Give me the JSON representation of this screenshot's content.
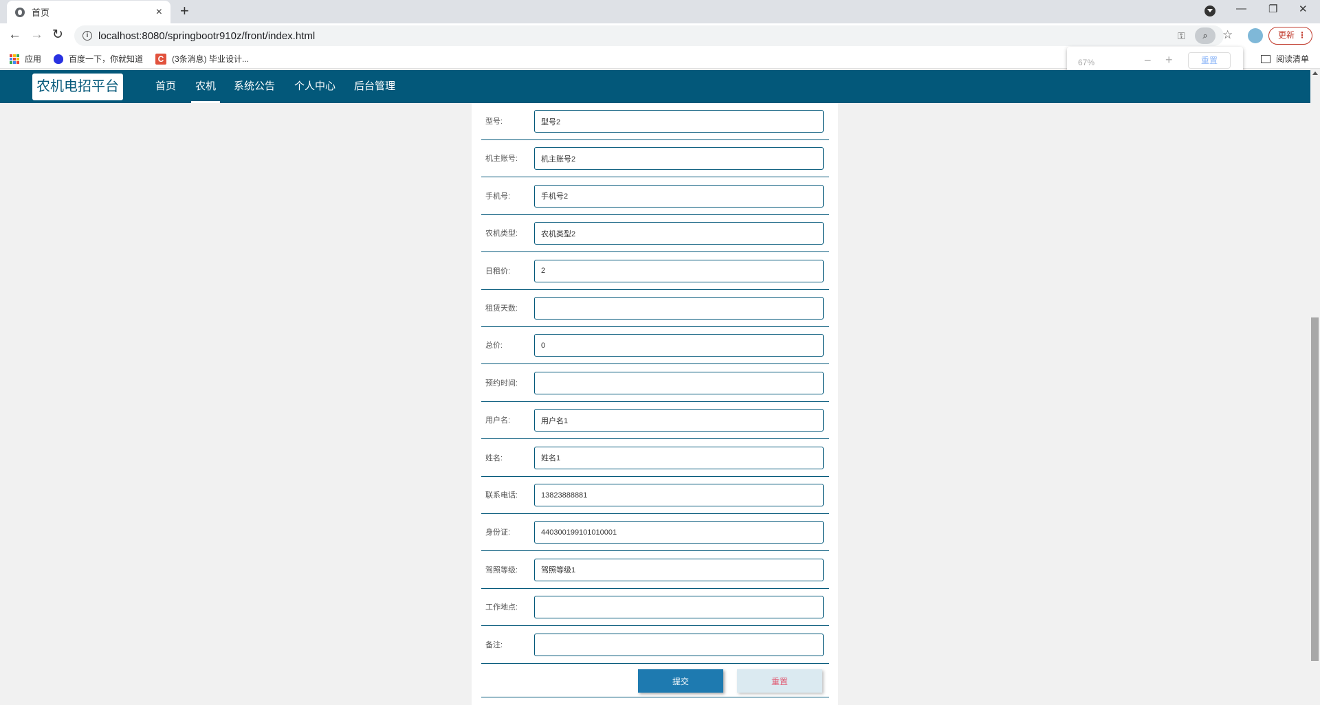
{
  "browser": {
    "tab_title": "首页",
    "tab_close": "×",
    "new_tab": "+",
    "url": "localhost:8080/springbootr910z/front/index.html",
    "update_label": "更新",
    "update_dots": "⋮",
    "window_controls": {
      "minimize": "—",
      "restore": "❐",
      "close": "✕"
    },
    "nav": {
      "back": "←",
      "forward": "→",
      "reload": "↻"
    },
    "bookmarks": [
      {
        "label": "应用"
      },
      {
        "label": "百度一下，你就知道"
      },
      {
        "label": "(3条消息) 毕业设计..."
      }
    ],
    "reading_list": "阅读清单",
    "zoom_popup": {
      "percent": "67%",
      "minus": "−",
      "plus": "+",
      "reset": "重置"
    }
  },
  "site": {
    "logo": "农机电招平台",
    "nav": [
      "首页",
      "农机",
      "系统公告",
      "个人中心",
      "后台管理"
    ],
    "active_nav": "农机"
  },
  "form": {
    "fields": [
      {
        "label": "型号:",
        "value": "型号2"
      },
      {
        "label": "机主账号:",
        "value": "机主账号2"
      },
      {
        "label": "手机号:",
        "value": "手机号2"
      },
      {
        "label": "农机类型:",
        "value": "农机类型2"
      },
      {
        "label": "日租价:",
        "value": "2"
      },
      {
        "label": "租赁天数:",
        "value": ""
      },
      {
        "label": "总价:",
        "value": "0"
      },
      {
        "label": "预约时间:",
        "value": ""
      },
      {
        "label": "用户名:",
        "value": "用户名1"
      },
      {
        "label": "姓名:",
        "value": "姓名1"
      },
      {
        "label": "联系电话:",
        "value": "13823888881"
      },
      {
        "label": "身份证:",
        "value": "440300199101010001"
      },
      {
        "label": "驾照等级:",
        "value": "驾照等级1"
      },
      {
        "label": "工作地点:",
        "value": ""
      },
      {
        "label": "备注:",
        "value": ""
      }
    ],
    "submit_label": "提交",
    "reset_label": "重置"
  },
  "colors": {
    "header": "#03587a",
    "submit": "#1e7ab0",
    "reset_text": "#e05a72"
  }
}
